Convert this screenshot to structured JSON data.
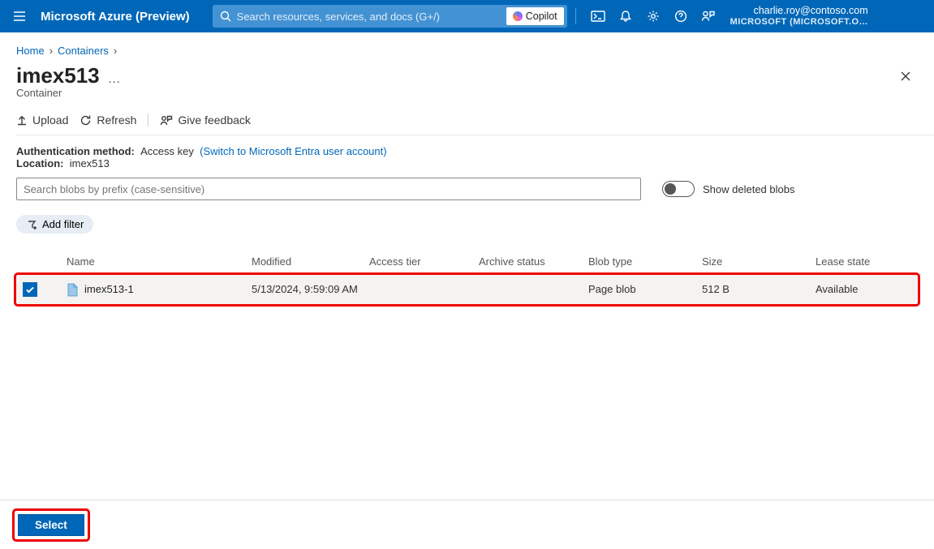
{
  "header": {
    "brand": "Microsoft Azure (Preview)",
    "search_placeholder": "Search resources, services, and docs (G+/)",
    "copilot_label": "Copilot",
    "user_email": "charlie.roy@contoso.com",
    "tenant": "MICROSOFT (MICROSOFT.ONMI..."
  },
  "breadcrumbs": {
    "home": "Home",
    "containers": "Containers"
  },
  "page": {
    "title": "imex513",
    "subtitle": "Container"
  },
  "toolbar": {
    "upload": "Upload",
    "refresh": "Refresh",
    "feedback": "Give feedback"
  },
  "meta": {
    "auth_label": "Authentication method:",
    "auth_value": "Access key",
    "switch_link": "(Switch to Microsoft Entra user account)",
    "location_label": "Location:",
    "location_value": "imex513"
  },
  "filters": {
    "search_placeholder": "Search blobs by prefix (case-sensitive)",
    "toggle_label": "Show deleted blobs",
    "add_filter": "Add filter"
  },
  "table": {
    "columns": {
      "name": "Name",
      "modified": "Modified",
      "tier": "Access tier",
      "archive": "Archive status",
      "type": "Blob type",
      "size": "Size",
      "lease": "Lease state"
    },
    "rows": [
      {
        "selected": true,
        "name": "imex513-1",
        "modified": "5/13/2024, 9:59:09 AM",
        "tier": "",
        "archive": "",
        "type": "Page blob",
        "size": "512 B",
        "lease": "Available"
      }
    ]
  },
  "footer": {
    "select": "Select"
  }
}
